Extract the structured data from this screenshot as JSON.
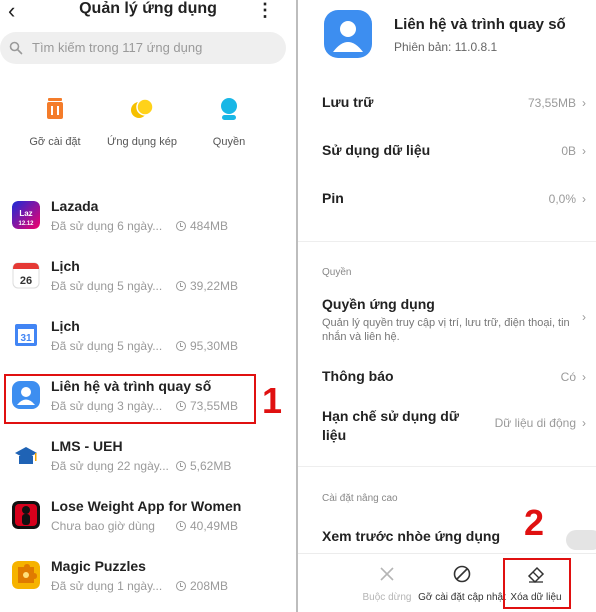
{
  "left": {
    "title": "Quản lý ứng dụng",
    "back_icon": "back-chevron-icon",
    "more_icon": "more-vertical-icon",
    "search_placeholder": "Tìm kiếm trong 117 ứng dụng",
    "quick_actions": [
      {
        "label": "Gỡ cài đặt",
        "icon": "trash-icon",
        "color": "#f47c2a"
      },
      {
        "label": "Ứng dụng kép",
        "icon": "dual-apps-icon",
        "color": "#f6c000"
      },
      {
        "label": "Quyền",
        "icon": "permissions-icon",
        "color": "#19b7e6"
      }
    ],
    "apps": [
      {
        "name": "Lazada",
        "usage": "Đã sử dụng 6 ngày...",
        "size": "484MB",
        "icon": "lazada-icon"
      },
      {
        "name": "Lịch",
        "usage": "Đã sử dụng 5 ngày...",
        "size": "39,22MB",
        "icon": "calendar-icon",
        "day": "26"
      },
      {
        "name": "Lịch",
        "usage": "Đã sử dụng 5 ngày...",
        "size": "95,30MB",
        "icon": "google-calendar-icon",
        "day": "31"
      },
      {
        "name": "Liên hệ và trình quay số",
        "usage": "Đã sử dụng 3 ngày...",
        "size": "73,55MB",
        "icon": "contacts-icon"
      },
      {
        "name": "LMS - UEH",
        "usage": "Đã sử dụng 22 ngày...",
        "size": "5,62MB",
        "icon": "lms-ueh-icon"
      },
      {
        "name": "Lose Weight App for Women",
        "usage": "Chưa bao giờ dùng",
        "size": "40,49MB",
        "icon": "lose-weight-icon"
      },
      {
        "name": "Magic Puzzles",
        "usage": "Đã sử dụng 1 ngày...",
        "size": "208MB",
        "icon": "magic-puzzles-icon"
      }
    ],
    "annotation_number": "1"
  },
  "right": {
    "app_name": "Liên hệ và trình quay số",
    "version": "Phiên bản: 11.0.8.1",
    "rows": [
      {
        "label": "Lưu trữ",
        "value": "73,55MB"
      },
      {
        "label": "Sử dụng dữ liệu",
        "value": "0B"
      },
      {
        "label": "Pin",
        "value": "0,0%"
      }
    ],
    "section_permissions": "Quyền",
    "permissions": {
      "label": "Quyền ứng dụng",
      "desc": "Quản lý quyền truy cập vị trí, lưu trữ, điện thoại, tin nhắn và liên hệ."
    },
    "notifications": {
      "label": "Thông báo",
      "value": "Có"
    },
    "data_restrict": {
      "label": "Hạn chế sử dụng dữ liệu",
      "value": "Dữ liệu di động"
    },
    "section_advanced": "Cài đặt nâng cao",
    "preview": {
      "label": "Xem trước nhòe ứng dụng"
    },
    "bottom": [
      {
        "label": "Buộc dừng",
        "icon": "close-x-icon",
        "enabled": false
      },
      {
        "label": "Gỡ cài đặt cập nhật",
        "icon": "block-icon",
        "enabled": true
      },
      {
        "label": "Xóa dữ liệu",
        "icon": "eraser-icon",
        "enabled": true
      }
    ],
    "annotation_number": "2"
  },
  "colors": {
    "highlight": "#e01010",
    "muted": "#9a9a9a",
    "contacts_blue": "#3d8ef0"
  }
}
